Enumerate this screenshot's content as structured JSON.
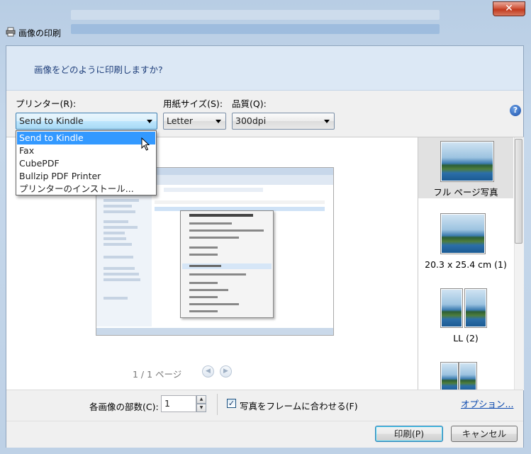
{
  "window": {
    "title": "画像の印刷",
    "close_glyph": "✕"
  },
  "header": {
    "question": "画像をどのように印刷しますか?"
  },
  "settings": {
    "printer_label": "プリンター(R):",
    "printer_value": "Send to Kindle",
    "paper_label": "用紙サイズ(S):",
    "paper_value": "Letter",
    "quality_label": "品質(Q):",
    "quality_value": "300dpi",
    "help_glyph": "?"
  },
  "printer_dropdown": {
    "options": [
      "Send to Kindle",
      "Fax",
      "CubePDF",
      "Bullzip PDF Printer",
      "プリンターのインストール..."
    ],
    "selected_index": 0
  },
  "preview": {
    "page_indicator": "1 / 1 ページ",
    "prev_glyph": "◀",
    "next_glyph": "▶"
  },
  "layouts": [
    {
      "label": "フル ページ写真"
    },
    {
      "label": "20.3 x 25.4 cm (1)"
    },
    {
      "label": "LL (2)"
    }
  ],
  "bottom": {
    "copies_label": "各画像の部数(C):",
    "copies_value": "1",
    "fit_label": "写真をフレームに合わせる(F)",
    "fit_checked": true,
    "options_link": "オプション..."
  },
  "buttons": {
    "print": "印刷(P)",
    "cancel": "キャンセル"
  }
}
